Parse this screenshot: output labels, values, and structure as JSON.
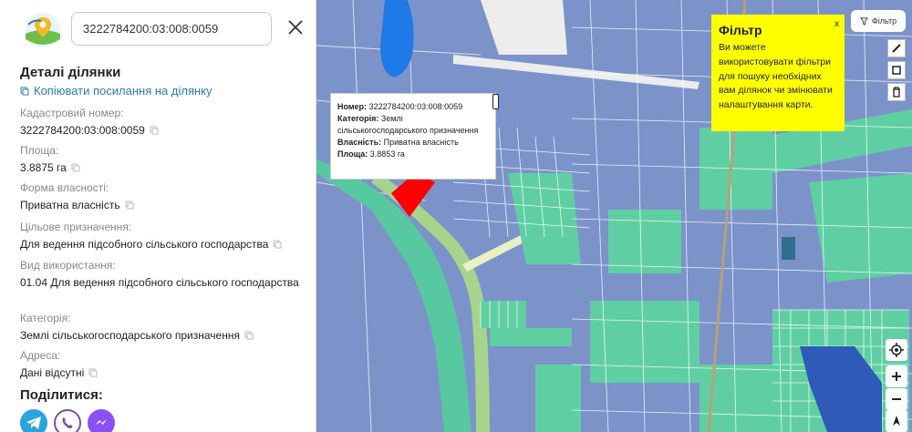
{
  "search": {
    "value": "3222784200:03:008:0059"
  },
  "details": {
    "title": "Деталі ділянки",
    "copy_link": "Копіювати посилання на ділянку",
    "fields": [
      {
        "label": "Кадастровий номер:",
        "value": "3222784200:03:008:0059"
      },
      {
        "label": "Площа:",
        "value": "3.8875 га"
      },
      {
        "label": "Форма власності:",
        "value": "Приватна власність"
      },
      {
        "label": "Цільове призначення:",
        "value": "Для ведення підсобного сільського господарства"
      },
      {
        "label": "Вид використання:",
        "value": "01.04 Для ведення підсобного сільського господарства"
      },
      {
        "label": "Категорія:",
        "value": "Землі сільськогосподарського призначення"
      },
      {
        "label": "Адреса:",
        "value": "Дані відсутні"
      }
    ]
  },
  "share": {
    "title": "Поділитися:",
    "services": [
      "telegram",
      "viber",
      "messenger"
    ]
  },
  "popup": {
    "number_label": "Номер:",
    "number": "3222784200:03:008:0059",
    "category_label": "Категорія:",
    "category": "Землі сільськогосподарського призначення",
    "ownership_label": "Власність:",
    "ownership": "Приватна власність",
    "area_label": "Площа:",
    "area": "3.8853 га"
  },
  "filter": {
    "title": "Фільтр",
    "text": "Ви можете використовувати фільтри для пошуку необхідних вам ділянок чи змінювати налаштування карти.",
    "close": "x",
    "button_label": "Фільтр"
  },
  "colors": {
    "parcel_blue": "#7c93c9",
    "parcel_green": "#5fcfa3",
    "selected": "#ff0000",
    "filter_bg": "#ffff00",
    "link": "#2a7ab8"
  }
}
